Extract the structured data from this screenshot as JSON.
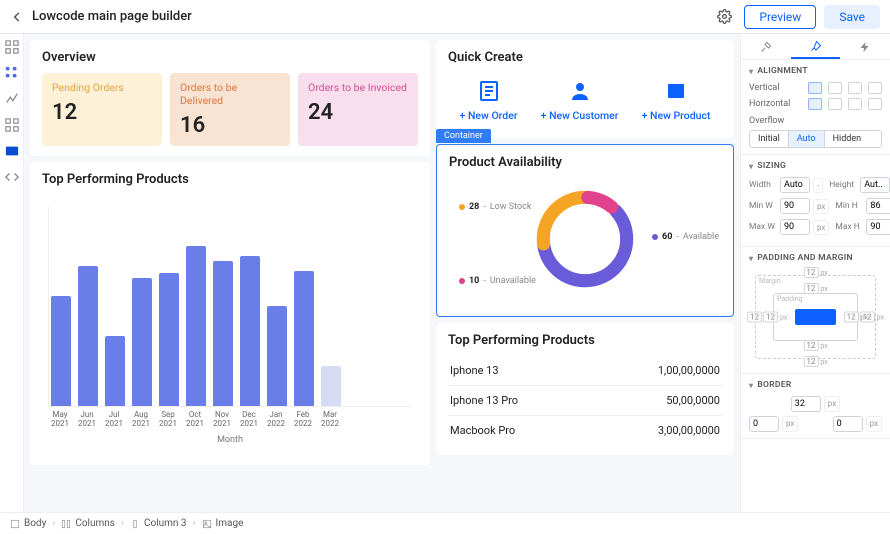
{
  "header": {
    "title": "Lowcode main page builder",
    "preview": "Preview",
    "save": "Save"
  },
  "overview": {
    "title": "Overview",
    "cards": [
      {
        "label": "Pending Orders",
        "value": "12"
      },
      {
        "label": "Orders to be Delivered",
        "value": "16"
      },
      {
        "label": "Orders to be Invoiced",
        "value": "24"
      }
    ]
  },
  "top_products_chart": {
    "title": "Top Performing Products",
    "xaxis": "Month"
  },
  "quick_create": {
    "title": "Quick Create",
    "items": [
      {
        "label": "+ New Order"
      },
      {
        "label": "+ New Customer"
      },
      {
        "label": "+ New Product"
      }
    ]
  },
  "container_badge": "Container",
  "availability": {
    "title": "Product Availability",
    "legend": [
      {
        "value": "28",
        "label": "Low Stock"
      },
      {
        "value": "60",
        "label": "Available"
      },
      {
        "value": "10",
        "label": "Unavailable"
      }
    ]
  },
  "product_table": {
    "title": "Top Performing Products",
    "rows": [
      {
        "name": "Iphone 13",
        "value": "1,00,00,0000"
      },
      {
        "name": "Iphone 13 Pro",
        "value": "50,00,0000"
      },
      {
        "name": "Macbook Pro",
        "value": "3,00,00,0000"
      }
    ]
  },
  "inspector": {
    "alignment": {
      "title": "ALIGNMENT",
      "vertical": "Vertical",
      "horizontal": "Horizontal",
      "overflow": "Overflow",
      "overflow_opts": [
        "Initial",
        "Auto",
        "Hidden"
      ]
    },
    "sizing": {
      "title": "SIZING",
      "width": "Width",
      "width_v": "Auto",
      "height": "Height",
      "height_v": "Aut..",
      "minw": "Min W",
      "minw_v": "90",
      "minh": "Min H",
      "minh_v": "86",
      "maxw": "Max W",
      "maxw_v": "90",
      "maxh": "Max H",
      "maxh_v": "90",
      "px": "px"
    },
    "spacing": {
      "title": "PADDING AND MARGIN",
      "margin": "Margin",
      "padding": "Padding",
      "val": "12",
      "px": "px"
    },
    "border": {
      "title": "BORDER",
      "val": "32",
      "zero": "0",
      "px": "px"
    }
  },
  "breadcrumb": [
    "Body",
    "Columns",
    "Column 3",
    "Image"
  ],
  "chart_data": {
    "type": "bar",
    "categories": [
      "May 2021",
      "Jun 2021",
      "Jul 2021",
      "Aug 2021",
      "Sep 2021",
      "Oct 2021",
      "Nov 2021",
      "Dec 2021",
      "Jan 2022",
      "Feb 2022",
      "Mar 2022"
    ],
    "values": [
      110,
      140,
      70,
      128,
      133,
      160,
      145,
      150,
      100,
      135,
      40
    ],
    "faded_index": 10,
    "ylim": [
      0,
      200
    ],
    "xlabel": "Month"
  },
  "chart_data_donut": {
    "type": "pie",
    "series": [
      {
        "name": "Low Stock",
        "value": 28,
        "color": "#f5a524"
      },
      {
        "name": "Available",
        "value": 60,
        "color": "#6a5bd9"
      },
      {
        "name": "Unavailable",
        "value": 10,
        "color": "#e2428c"
      }
    ]
  }
}
